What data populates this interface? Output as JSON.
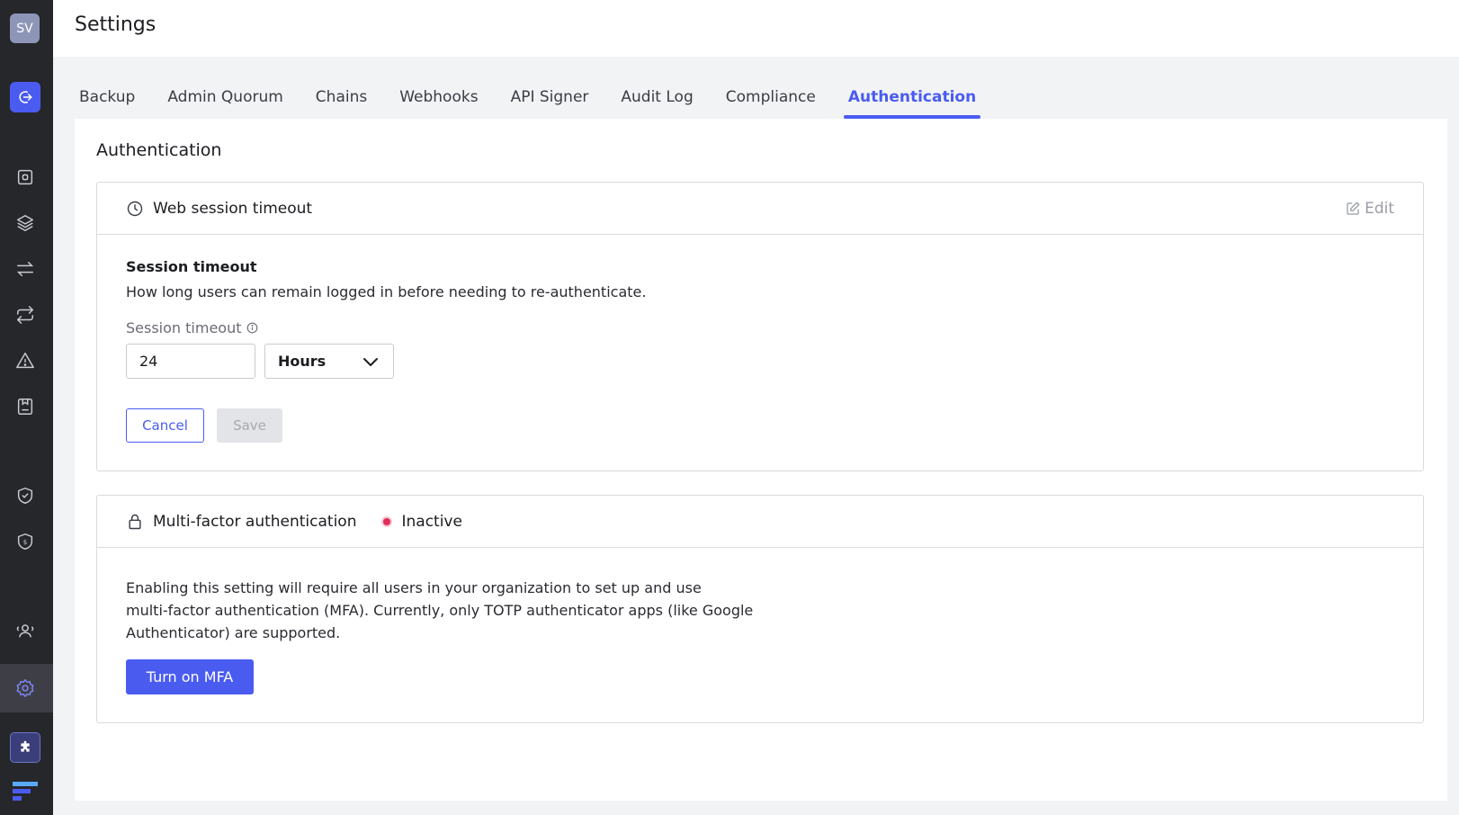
{
  "user": {
    "initials": "SV"
  },
  "header": {
    "title": "Settings"
  },
  "tabs": [
    {
      "label": "Backup"
    },
    {
      "label": "Admin Quorum"
    },
    {
      "label": "Chains"
    },
    {
      "label": "Webhooks"
    },
    {
      "label": "API Signer"
    },
    {
      "label": "Audit Log"
    },
    {
      "label": "Compliance"
    },
    {
      "label": "Authentication",
      "active": true
    }
  ],
  "sidebar": {
    "items": [
      {
        "icon": "logout-icon"
      },
      {
        "icon": "vault-icon"
      },
      {
        "icon": "layers-icon"
      },
      {
        "icon": "transfer-icon"
      },
      {
        "icon": "repeat-icon"
      },
      {
        "icon": "alert-triangle-icon"
      },
      {
        "icon": "address-book-icon"
      },
      {
        "icon": "shield-check-icon"
      },
      {
        "icon": "shield-dollar-icon"
      },
      {
        "icon": "users-icon"
      },
      {
        "icon": "settings-gear-icon",
        "active": true
      },
      {
        "icon": "puzzle-icon"
      }
    ]
  },
  "section": {
    "title": "Authentication"
  },
  "session_card": {
    "title": "Web session timeout",
    "edit_label": "Edit",
    "field_title": "Session timeout",
    "field_description": "How long users can remain logged in before needing to re-authenticate.",
    "field_label": "Session timeout",
    "value": "24",
    "unit": "Hours",
    "cancel_label": "Cancel",
    "save_label": "Save"
  },
  "mfa_card": {
    "title": "Multi-factor authentication",
    "status": "Inactive",
    "description_lines": [
      "Enabling this setting will require all users in your organization to set up and use",
      "multi-factor authentication (MFA). Currently, only TOTP authenticator apps (like Google",
      "Authenticator) are supported."
    ],
    "button_label": "Turn on MFA"
  },
  "colors": {
    "accent": "#4a5cf0",
    "sidebar_bg": "#26272b",
    "status_inactive": "#e02c5c"
  }
}
